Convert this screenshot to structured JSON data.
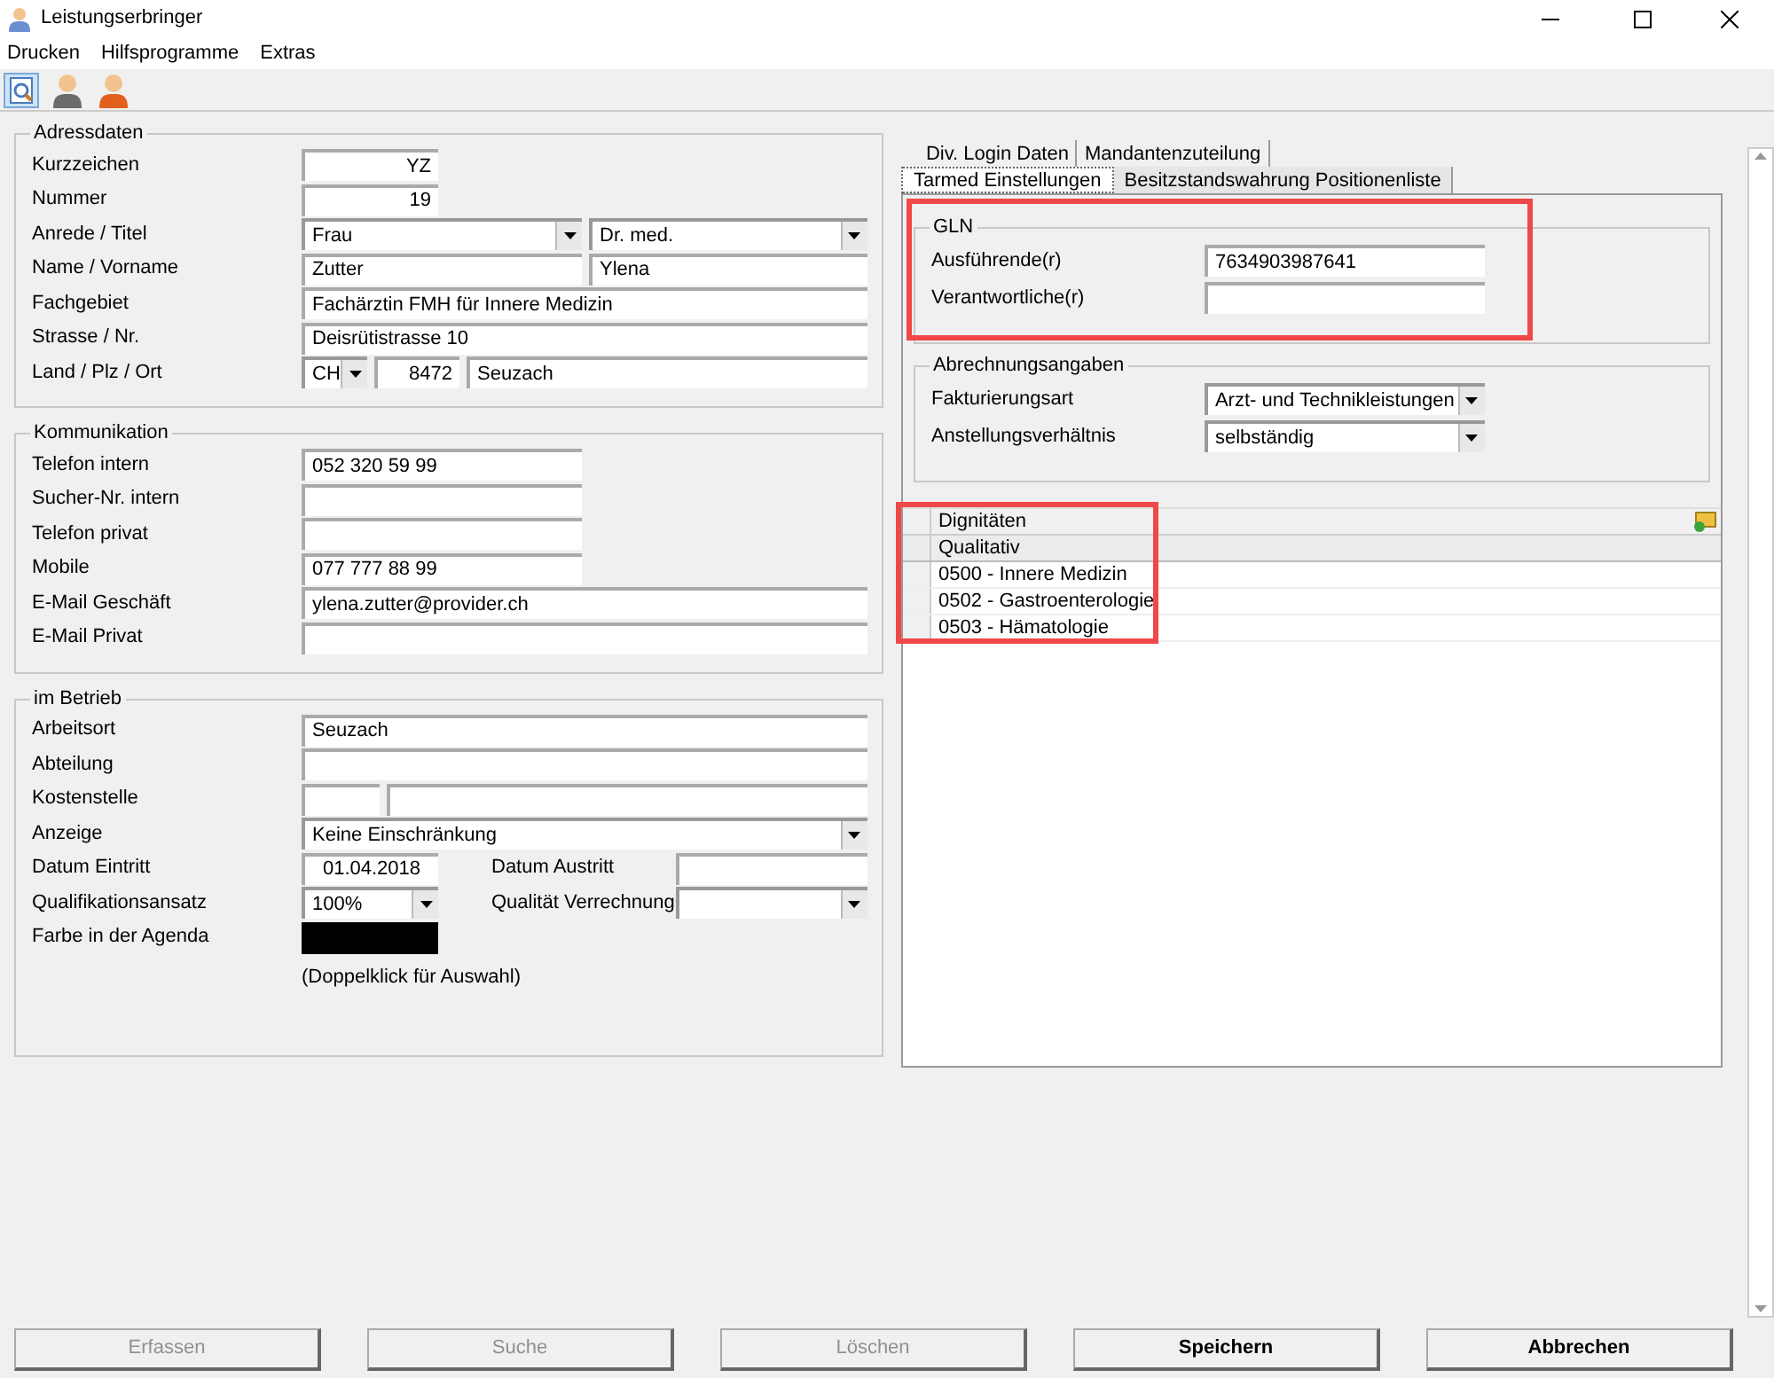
{
  "window": {
    "title": "Leistungserbringer"
  },
  "menu": [
    "Drucken",
    "Hilfsprogramme",
    "Extras"
  ],
  "toolbar": [
    {
      "kind": "preview",
      "selected": true
    },
    {
      "kind": "person-grey",
      "selected": false
    },
    {
      "kind": "person-orange",
      "selected": false
    }
  ],
  "sections": [
    {
      "title": "Adressdaten",
      "rows": [
        {
          "label": "Kurzzeichen",
          "fields": [
            {
              "kind": "number",
              "value": "YZ"
            }
          ]
        },
        {
          "label": "Nummer",
          "fields": [
            {
              "kind": "number",
              "value": "19"
            }
          ]
        },
        {
          "label": "Anrede / Titel",
          "fields": [
            {
              "kind": "select",
              "value": "Frau"
            },
            {
              "kind": "select",
              "value": "Dr. med."
            }
          ]
        },
        {
          "label": "Name / Vorname",
          "fields": [
            {
              "kind": "text",
              "value": "Zutter"
            },
            {
              "kind": "text",
              "value": "Ylena"
            }
          ]
        },
        {
          "label": "Fachgebiet",
          "fields": [
            {
              "kind": "text",
              "value": "Fachärztin FMH für Innere Medizin"
            }
          ]
        },
        {
          "label": "Strasse / Nr.",
          "fields": [
            {
              "kind": "text",
              "value": "Deisrütistrasse 10"
            }
          ]
        },
        {
          "label": "Land / Plz / Ort",
          "fields": [
            {
              "kind": "select",
              "value": "CH"
            },
            {
              "kind": "number",
              "value": "8472"
            },
            {
              "kind": "text",
              "value": "Seuzach"
            }
          ]
        }
      ]
    },
    {
      "title": "Kommunikation",
      "rows": [
        {
          "label": "Telefon intern",
          "fields": [
            {
              "kind": "text",
              "value": "052 320 59 99"
            }
          ]
        },
        {
          "label": "Sucher-Nr. intern",
          "fields": [
            {
              "kind": "text"
            }
          ]
        },
        {
          "label": "Telefon privat",
          "fields": [
            {
              "kind": "text"
            }
          ]
        },
        {
          "label": "Mobile",
          "fields": [
            {
              "kind": "text",
              "value": "077 777 88 99"
            }
          ]
        },
        {
          "label": "E-Mail Geschäft",
          "fields": [
            {
              "kind": "text",
              "value": "ylena.zutter@provider.ch"
            }
          ]
        },
        {
          "label": "E-Mail Privat",
          "fields": [
            {
              "kind": "text"
            }
          ]
        }
      ]
    },
    {
      "title": "im Betrieb",
      "rows": [
        {
          "label": "Arbeitsort",
          "fields": [
            {
              "kind": "text",
              "value": "Seuzach"
            }
          ]
        },
        {
          "label": "Abteilung",
          "fields": [
            {
              "kind": "text"
            }
          ]
        },
        {
          "label": "Kostenstelle",
          "fields": [
            {
              "kind": "text"
            },
            {
              "kind": "text"
            }
          ]
        },
        {
          "label": "Anzeige",
          "fields": [
            {
              "kind": "select",
              "value": "Keine Einschränkung"
            }
          ]
        },
        {
          "label": "Datum Eintritt",
          "fields": [
            {
              "kind": "date",
              "value": "01.04.2018"
            },
            {
              "kind": "label",
              "value": "Datum Austritt"
            },
            {
              "kind": "text"
            }
          ]
        },
        {
          "label": "Qualifikationsansatz",
          "fields": [
            {
              "kind": "select",
              "value": "100%"
            },
            {
              "kind": "label",
              "value": "Qualität Verrechnung"
            },
            {
              "kind": "select"
            }
          ]
        },
        {
          "label": "Farbe in der Agenda",
          "fields": [
            {
              "kind": "color",
              "color": "#000000"
            }
          ]
        }
      ],
      "note": "(Doppelklick für Auswahl)"
    }
  ],
  "tabs_back": [
    {
      "label": "Div. Login Daten",
      "selected": false
    },
    {
      "label": "Mandantenzuteilung",
      "selected": false
    }
  ],
  "tabs_front": [
    {
      "label": "Tarmed Einstellungen",
      "selected": true
    },
    {
      "label": "Besitzstandswahrung Positionenliste",
      "selected": false
    }
  ],
  "gln": {
    "title": "GLN",
    "highlighted": true,
    "rows": [
      {
        "label": "Ausführende(r)",
        "value": "7634903987641"
      },
      {
        "label": "Verantwortliche(r)"
      }
    ]
  },
  "abrechnung": {
    "title": "Abrechnungsangaben",
    "rows": [
      {
        "label": "Fakturierungsart",
        "value": "Arzt- und Technikleistungen"
      },
      {
        "label": "Anstellungsverhältnis",
        "value": "selbständig"
      }
    ]
  },
  "table": {
    "highlighted": true,
    "header": "Dignitäten",
    "group": "Qualitativ",
    "rows": [
      "0500 - Innere Medizin",
      "0502 - Gastroenterologie",
      "0503 - Hämatologie"
    ]
  },
  "buttons": [
    {
      "label": "Erfassen",
      "disabled": true
    },
    {
      "label": "Suche",
      "disabled": true
    },
    {
      "label": "Löschen",
      "disabled": true
    },
    {
      "label": "Speichern",
      "disabled": false
    },
    {
      "label": "Abbrechen",
      "disabled": false
    }
  ]
}
